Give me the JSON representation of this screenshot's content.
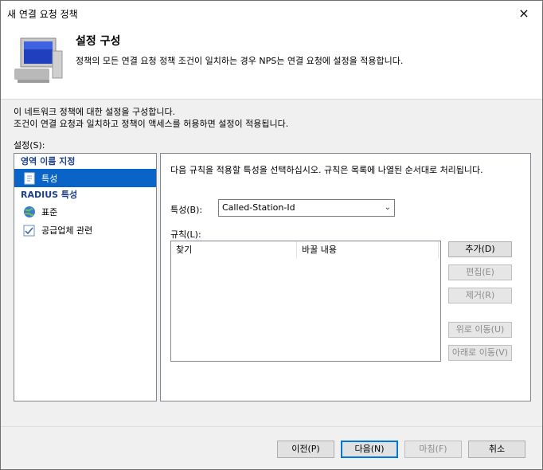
{
  "window": {
    "title": "새 연결 요청 정책",
    "close_icon": "×"
  },
  "header": {
    "title": "설정 구성",
    "description": "정책의 모든 연결 요청 정책 조건이 일치하는 경우 NPS는 연결 요청에 설정을 적용합니다."
  },
  "intro": {
    "line1": "이 네트워크 정책에 대한 설정을 구성합니다.",
    "line2": "조건이 연결 요청과 일치하고 정책이 액세스를 허용하면 설정이 적용됩니다."
  },
  "settings_label": "설정(S):",
  "tree": {
    "group1": "영역 이름 지정",
    "item_attribute": "특성",
    "group2": "RADIUS 특성",
    "item_standard": "표준",
    "item_vendor": "공급업체 관련"
  },
  "panel": {
    "description": "다음 규칙을 적용할 특성을 선택하십시오. 규칙은 목록에 나열된 순서대로 처리됩니다.",
    "attribute_label": "특성(B):",
    "attribute_value": "Called-Station-Id",
    "rules_label": "규칙(L):",
    "col_find": "찾기",
    "col_replace": "바꿀 내용"
  },
  "buttons": {
    "add": "추가(D)",
    "edit": "편집(E)",
    "remove": "제거(R)",
    "move_up": "위로 이동(U)",
    "move_down": "아래로 이동(V)",
    "prev": "이전(P)",
    "next": "다음(N)",
    "finish": "마침(F)",
    "cancel": "취소"
  }
}
